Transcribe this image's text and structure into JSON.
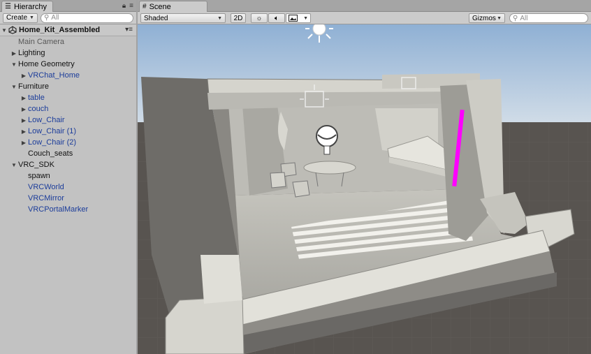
{
  "hierarchy": {
    "tab_label": "Hierarchy",
    "create_label": "Create",
    "search_placeholder": "All",
    "scene_name": "Home_Kit_Assembled",
    "items": [
      {
        "label": "Main Camera",
        "depth": 1,
        "arrow": "",
        "style": "gray"
      },
      {
        "label": "Lighting",
        "depth": 1,
        "arrow": "▶",
        "style": "normal"
      },
      {
        "label": "Home Geometry",
        "depth": 1,
        "arrow": "▼",
        "style": "normal"
      },
      {
        "label": "VRChat_Home",
        "depth": 2,
        "arrow": "▶",
        "style": "prefab"
      },
      {
        "label": "Furniture",
        "depth": 1,
        "arrow": "▼",
        "style": "normal"
      },
      {
        "label": "table",
        "depth": 2,
        "arrow": "▶",
        "style": "prefab"
      },
      {
        "label": "couch",
        "depth": 2,
        "arrow": "▶",
        "style": "prefab"
      },
      {
        "label": "Low_Chair",
        "depth": 2,
        "arrow": "▶",
        "style": "prefab"
      },
      {
        "label": "Low_Chair (1)",
        "depth": 2,
        "arrow": "▶",
        "style": "prefab"
      },
      {
        "label": "Low_Chair (2)",
        "depth": 2,
        "arrow": "▶",
        "style": "prefab"
      },
      {
        "label": "Couch_seats",
        "depth": 2,
        "arrow": "",
        "style": "normal"
      },
      {
        "label": "VRC_SDK",
        "depth": 1,
        "arrow": "▼",
        "style": "normal"
      },
      {
        "label": "spawn",
        "depth": 2,
        "arrow": "",
        "style": "normal"
      },
      {
        "label": "VRCWorld",
        "depth": 2,
        "arrow": "",
        "style": "prefab"
      },
      {
        "label": "VRCMirror",
        "depth": 2,
        "arrow": "",
        "style": "prefab"
      },
      {
        "label": "VRCPortalMarker",
        "depth": 2,
        "arrow": "",
        "style": "prefab"
      }
    ]
  },
  "scene": {
    "tab_label": "Scene",
    "shading_mode": "Shaded",
    "mode_2d": "2D",
    "gizmos_label": "Gizmos",
    "search_placeholder": "All"
  },
  "icons": {
    "hierarchy_tab": "list-icon",
    "scene_tab": "grid-icon",
    "lock": "lock-icon",
    "menu": "menu-icon",
    "light": "sun-icon",
    "audio": "speaker-icon",
    "effects": "image-icon",
    "search": "magnifier-icon",
    "scene_asset": "unity-logo-icon"
  },
  "colors": {
    "prefab_text": "#1b3c9a",
    "panel_bg": "#c2c2c2",
    "sky_top": "#8fb0d4",
    "ground": "#585450",
    "spawn_marker": "#ff00ff"
  }
}
